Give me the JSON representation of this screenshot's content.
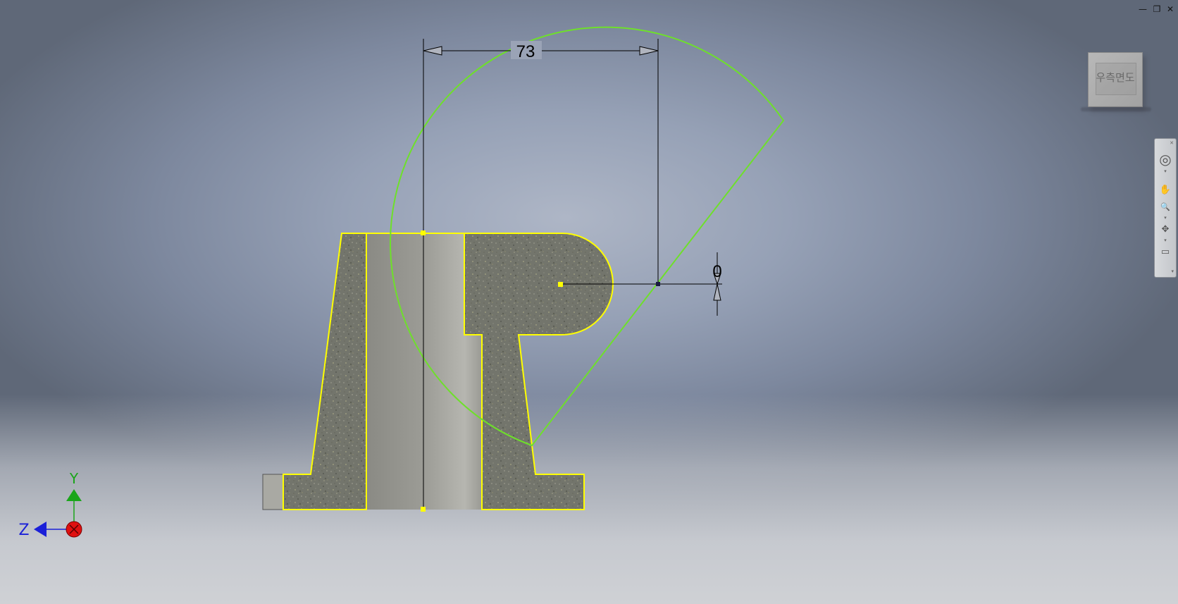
{
  "window": {
    "minimize_icon": "minimize-icon",
    "restore_icon": "restore-icon",
    "close_icon": "close-icon",
    "minimize": "—",
    "restore": "❐",
    "close": "✕"
  },
  "viewcube": {
    "label": "우측면도"
  },
  "navbar": {
    "close": "✕",
    "steering_wheel": "◎",
    "pan": "✋",
    "zoom": "🔍",
    "orbit": "✥",
    "look_at": "▭",
    "expand": "▾",
    "icons": [
      "steering-wheel-icon",
      "pan-icon",
      "zoom-icon",
      "orbit-icon",
      "look-at-icon"
    ]
  },
  "dimensions": {
    "horizontal": "73",
    "angular": "0"
  },
  "axes": {
    "y_label": "Y",
    "z_label": "Z",
    "y_color": "#1aa51a",
    "z_color": "#1b20d8",
    "x_color": "#e01010"
  },
  "colors": {
    "sketch_profile": "#ffff00",
    "revolve_preview": "#6ee02a",
    "section_fill": "#77786f",
    "bore_fill": "#a3a39c",
    "dimension_line": "#000000"
  }
}
